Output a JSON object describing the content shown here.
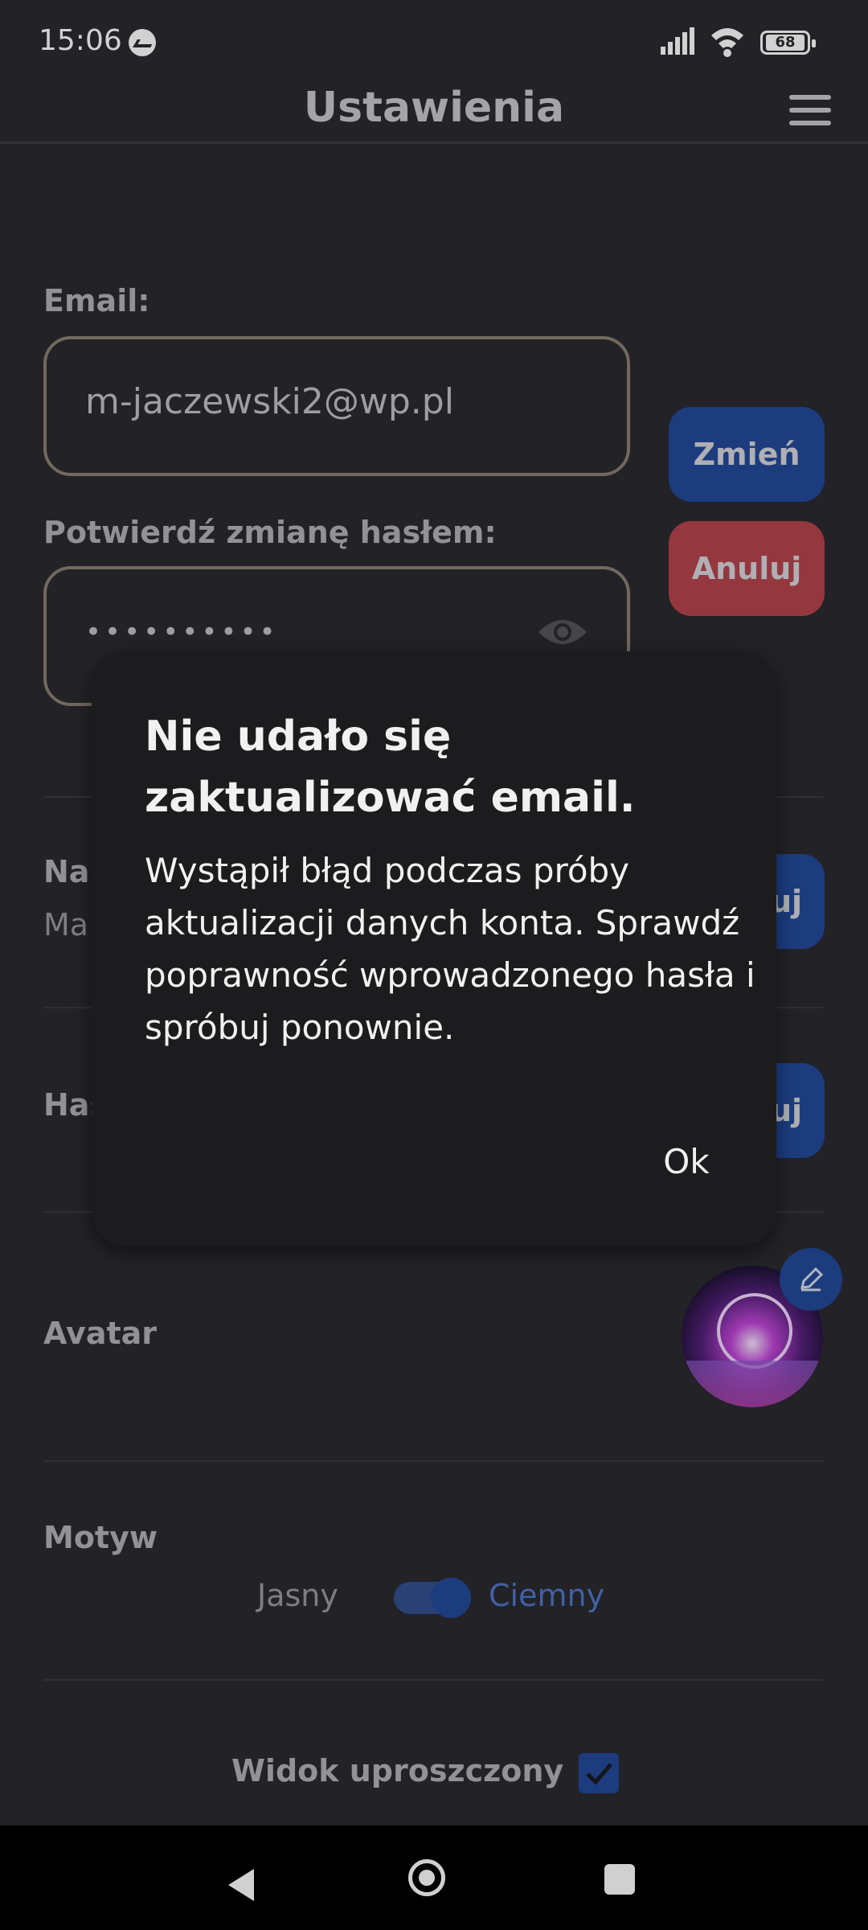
{
  "status_bar": {
    "time": "15:06",
    "battery": "68",
    "icons": [
      "messenger-icon",
      "signal-icon",
      "wifi-icon",
      "battery-icon"
    ]
  },
  "header": {
    "title": "Ustawienia",
    "menu_icon": "hamburger-menu-icon"
  },
  "email_section": {
    "label": "Email:",
    "value": "m-jaczewski2@wp.pl",
    "confirm_label": "Potwierdź zmianę hasłem:",
    "password_mask": "••••••••••",
    "change_button": "Zmień",
    "cancel_button": "Anuluj"
  },
  "name_section": {
    "label_partial": "Na",
    "value_partial": "Ma",
    "button_partial": "uj"
  },
  "password_section": {
    "label_partial": "Has",
    "button_partial": "uj"
  },
  "avatar_section": {
    "label": "Avatar"
  },
  "theme_section": {
    "label": "Motyw",
    "light": "Jasny",
    "dark": "Ciemny",
    "selected": "Ciemny"
  },
  "simple_view": {
    "label": "Widok uproszczony",
    "checked": true
  },
  "dialog": {
    "title": "Nie udało się zaktualizować email.",
    "message": "Wystąpił błąd podczas próby aktualizacji danych konta. Sprawdź poprawność wprowadzonego hasła i spróbuj ponownie.",
    "ok": "Ok"
  },
  "nav": {
    "back": "back-icon",
    "home": "home-icon",
    "recent": "recent-apps-icon"
  }
}
